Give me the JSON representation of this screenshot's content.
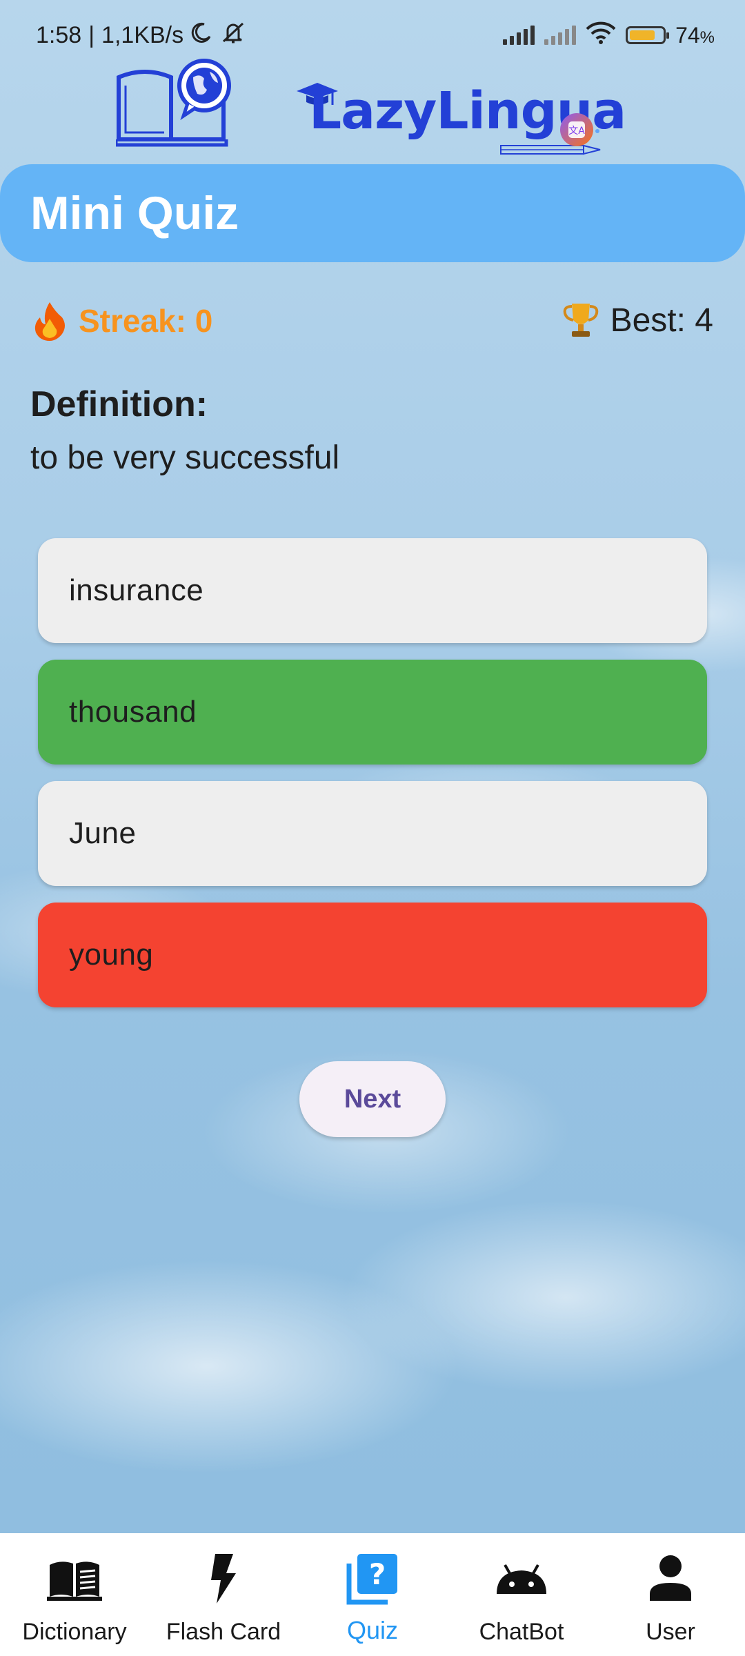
{
  "status_bar": {
    "time": "1:58",
    "separator": "|",
    "network_speed": "1,1KB/s",
    "battery_percent": "74",
    "battery_unit": "%",
    "icons": [
      "moon-icon",
      "mute-icon",
      "signal-icon",
      "signal-x-icon",
      "wifi-icon",
      "battery-icon"
    ]
  },
  "logo": {
    "text": "LazyLingua",
    "colors": {
      "primary": "#2340d6"
    }
  },
  "header": {
    "title": "Mini Quiz"
  },
  "stats": {
    "streak_label": "Streak: 0",
    "best_label": "Best: 4",
    "streak_icon": "fire-icon",
    "best_icon": "trophy-icon"
  },
  "question": {
    "label": "Definition:",
    "text": "to be very successful"
  },
  "options": [
    {
      "label": "insurance",
      "state": "neutral"
    },
    {
      "label": "thousand",
      "state": "correct"
    },
    {
      "label": "June",
      "state": "neutral"
    },
    {
      "label": "young",
      "state": "wrong"
    }
  ],
  "colors": {
    "header": "#64b4f6",
    "correct": "#4fb050",
    "wrong": "#f44331",
    "neutral": "#eeeeee",
    "streak": "#f7931e",
    "active_nav": "#2196f3"
  },
  "next_button": {
    "label": "Next"
  },
  "bottom_nav": {
    "items": [
      {
        "label": "Dictionary",
        "icon": "book-icon",
        "active": false
      },
      {
        "label": "Flash Card",
        "icon": "flash-icon",
        "active": false
      },
      {
        "label": "Quiz",
        "icon": "quiz-icon",
        "active": true
      },
      {
        "label": "ChatBot",
        "icon": "android-icon",
        "active": false
      },
      {
        "label": "User",
        "icon": "user-icon",
        "active": false
      }
    ]
  }
}
